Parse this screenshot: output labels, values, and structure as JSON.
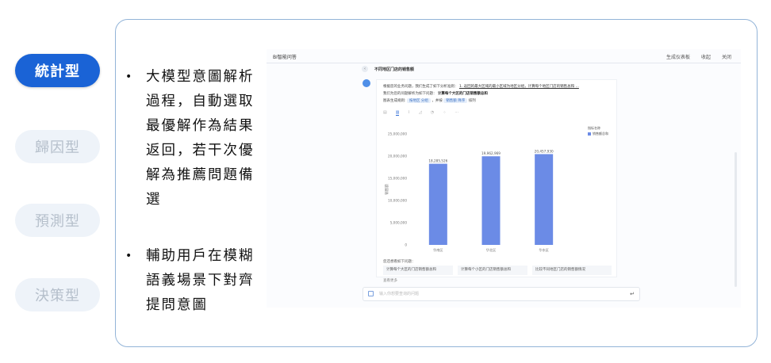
{
  "nav": {
    "items": [
      {
        "label": "統計型",
        "active": true
      },
      {
        "label": "歸因型",
        "active": false
      },
      {
        "label": "預測型",
        "active": false
      },
      {
        "label": "決策型",
        "active": false
      }
    ]
  },
  "bullets": [
    "大模型意圖解析過程，自動選取最優解作為結果返回，若干次優解為推薦問題備選",
    "輔助用戶在模糊語義場景下對齊提問意圖"
  ],
  "screenshot": {
    "title": "BI智能问答",
    "actions": [
      "生成仪表板",
      "收起",
      "关闭"
    ],
    "question": "不同地区门店的销售额",
    "intro": "根据您的业务问题，我们生成了如下分析准则：",
    "intro_link": "1. 返回的最大区域的最小区域为地区分组，计算每个地区门店的销售总和 ...",
    "parse_prefix": "我们为您的问题解析为如下问题：",
    "parse_bold": "计算每个大区的门店销售额总和",
    "config_prefix": "图表生成规则:",
    "config_tag1": "按地区 分组",
    "config_mid": "，并按",
    "config_tag2": "销售额 降序",
    "config_suffix": "排列",
    "legend_title": "指标名称",
    "legend_item": "销售额总和",
    "rec_title": "您还想看如下问题：",
    "recs": [
      "计算每个大区的门店销售额总和",
      "计算每个小区的门店销售额总和",
      "比较不同地区门店的销售额情况"
    ],
    "more": "查看更多",
    "input_placeholder": "输入你想要查询的问题"
  },
  "chart_data": {
    "type": "bar",
    "categories": [
      "华南区",
      "华北区",
      "华东区"
    ],
    "values": [
      18285526,
      19962969,
      20457930
    ],
    "value_labels": [
      "18,285,526",
      "19,962,969",
      "20,457,930"
    ],
    "ylim": [
      0,
      25000000
    ],
    "yticks": [
      "25,000,000",
      "20,000,000",
      "15,000,000",
      "10,000,000",
      "5,000,000",
      "0"
    ],
    "ylabel": "销售额",
    "color": "#6b8be6",
    "grid": false,
    "legend": "right"
  },
  "colors": {
    "accent": "#1a63d6",
    "panel_border": "#93b4d8",
    "inactive_pill": "#eef3f9"
  }
}
